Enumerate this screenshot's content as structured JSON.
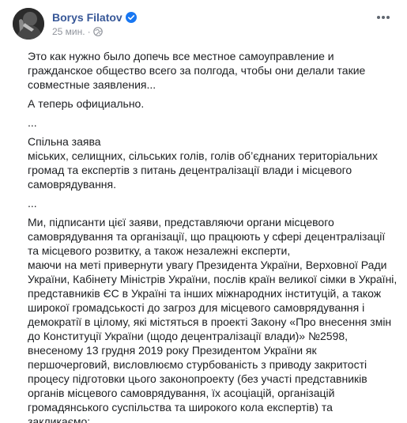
{
  "post": {
    "author": "Borys Filatov",
    "time": "25 мин.",
    "dot": "·",
    "paragraphs": [
      "Это как нужно было допечь все местное самоуправление и гражданское общество всего за полгода, чтобы они делали такие совместные заявления...",
      "А теперь официально.",
      "...",
      "Спільна заява\nміських, селищних, сільських голів, голів об’єднаних територіальних громад та експертів з питань децентралізації влади і місцевого самоврядування.",
      "...",
      "Ми, підписанти цієї заяви, представляючи органи місцевого самоврядування та організації, що працюють у сфері децентралізації та місцевого розвитку, а також незалежні експерти,\nмаючи на меті привернути увагу Президента України, Верховної Ради України, Кабінету Міністрів України, послів країн великої сімки в Україні, представників ЄС в Україні та інших міжнародних інституцій, а також широкої громадськості до загроз для місцевого самоврядування і демократії в цілому, які містяться в проекті Закону «Про внесення змін до Конституції України (щодо децентралізації влади)» №2598, внесеному 13 грудня 2019 року Президентом України як першочерговий, висловлюємо стурбованість з приводу закритості процесу підготовки цього законопроекту (без участі представників органів місцевого самоврядування, їх асоціацій, організацій громадянського суспільства та широкого кола експертів) та закликаємо:"
    ]
  },
  "icons": {
    "verified": "verified-badge-icon",
    "audience": "globe-icon",
    "more": "more-options-icon"
  },
  "colors": {
    "name": "#385898",
    "meta": "#90949c",
    "text": "#1c1e21",
    "verified": "#1877f2"
  }
}
